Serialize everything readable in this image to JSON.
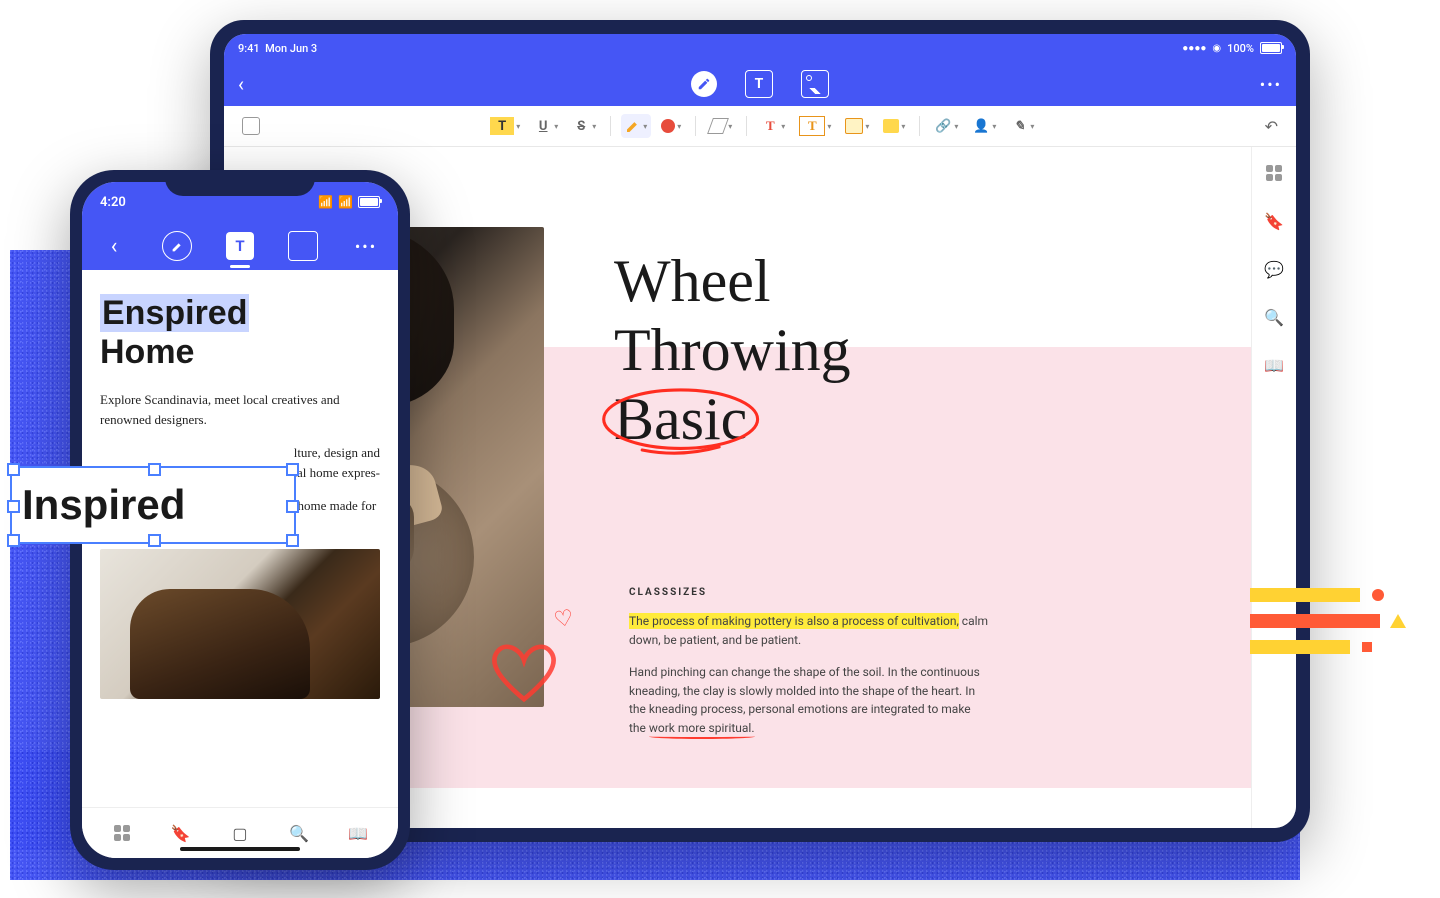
{
  "tablet": {
    "status": {
      "time": "9:41",
      "date": "Mon Jun 3",
      "battery": "100%"
    },
    "document": {
      "title_lines": [
        "Wheel",
        "Throwing",
        "Basic"
      ],
      "section_label": "CLASSSIZES",
      "para1_highlighted": "The process of making pottery is also a process of cultivation,",
      "para1_rest": " calm down, be patient, and be patient.",
      "para2": "Hand pinching can change the shape of the soil. In the continuous kneading, the clay is slowly molded into the shape of the heart. In the kneading process, personal emotions are integrated to make the ",
      "para2_underlined": "work more spiritual."
    }
  },
  "phone": {
    "status_time": "4:20",
    "title_selected": "Enspired",
    "title_rest": "Home",
    "body_p1": "Explore Scandinavia, meet local creatives and renowned designers.",
    "body_p2_partial1": "lture, design and",
    "body_p2_partial2": "nal home expres-",
    "body_p3": "Not a space built on perfection. But a home made for living."
  },
  "floating_edit_text": "Inspired"
}
